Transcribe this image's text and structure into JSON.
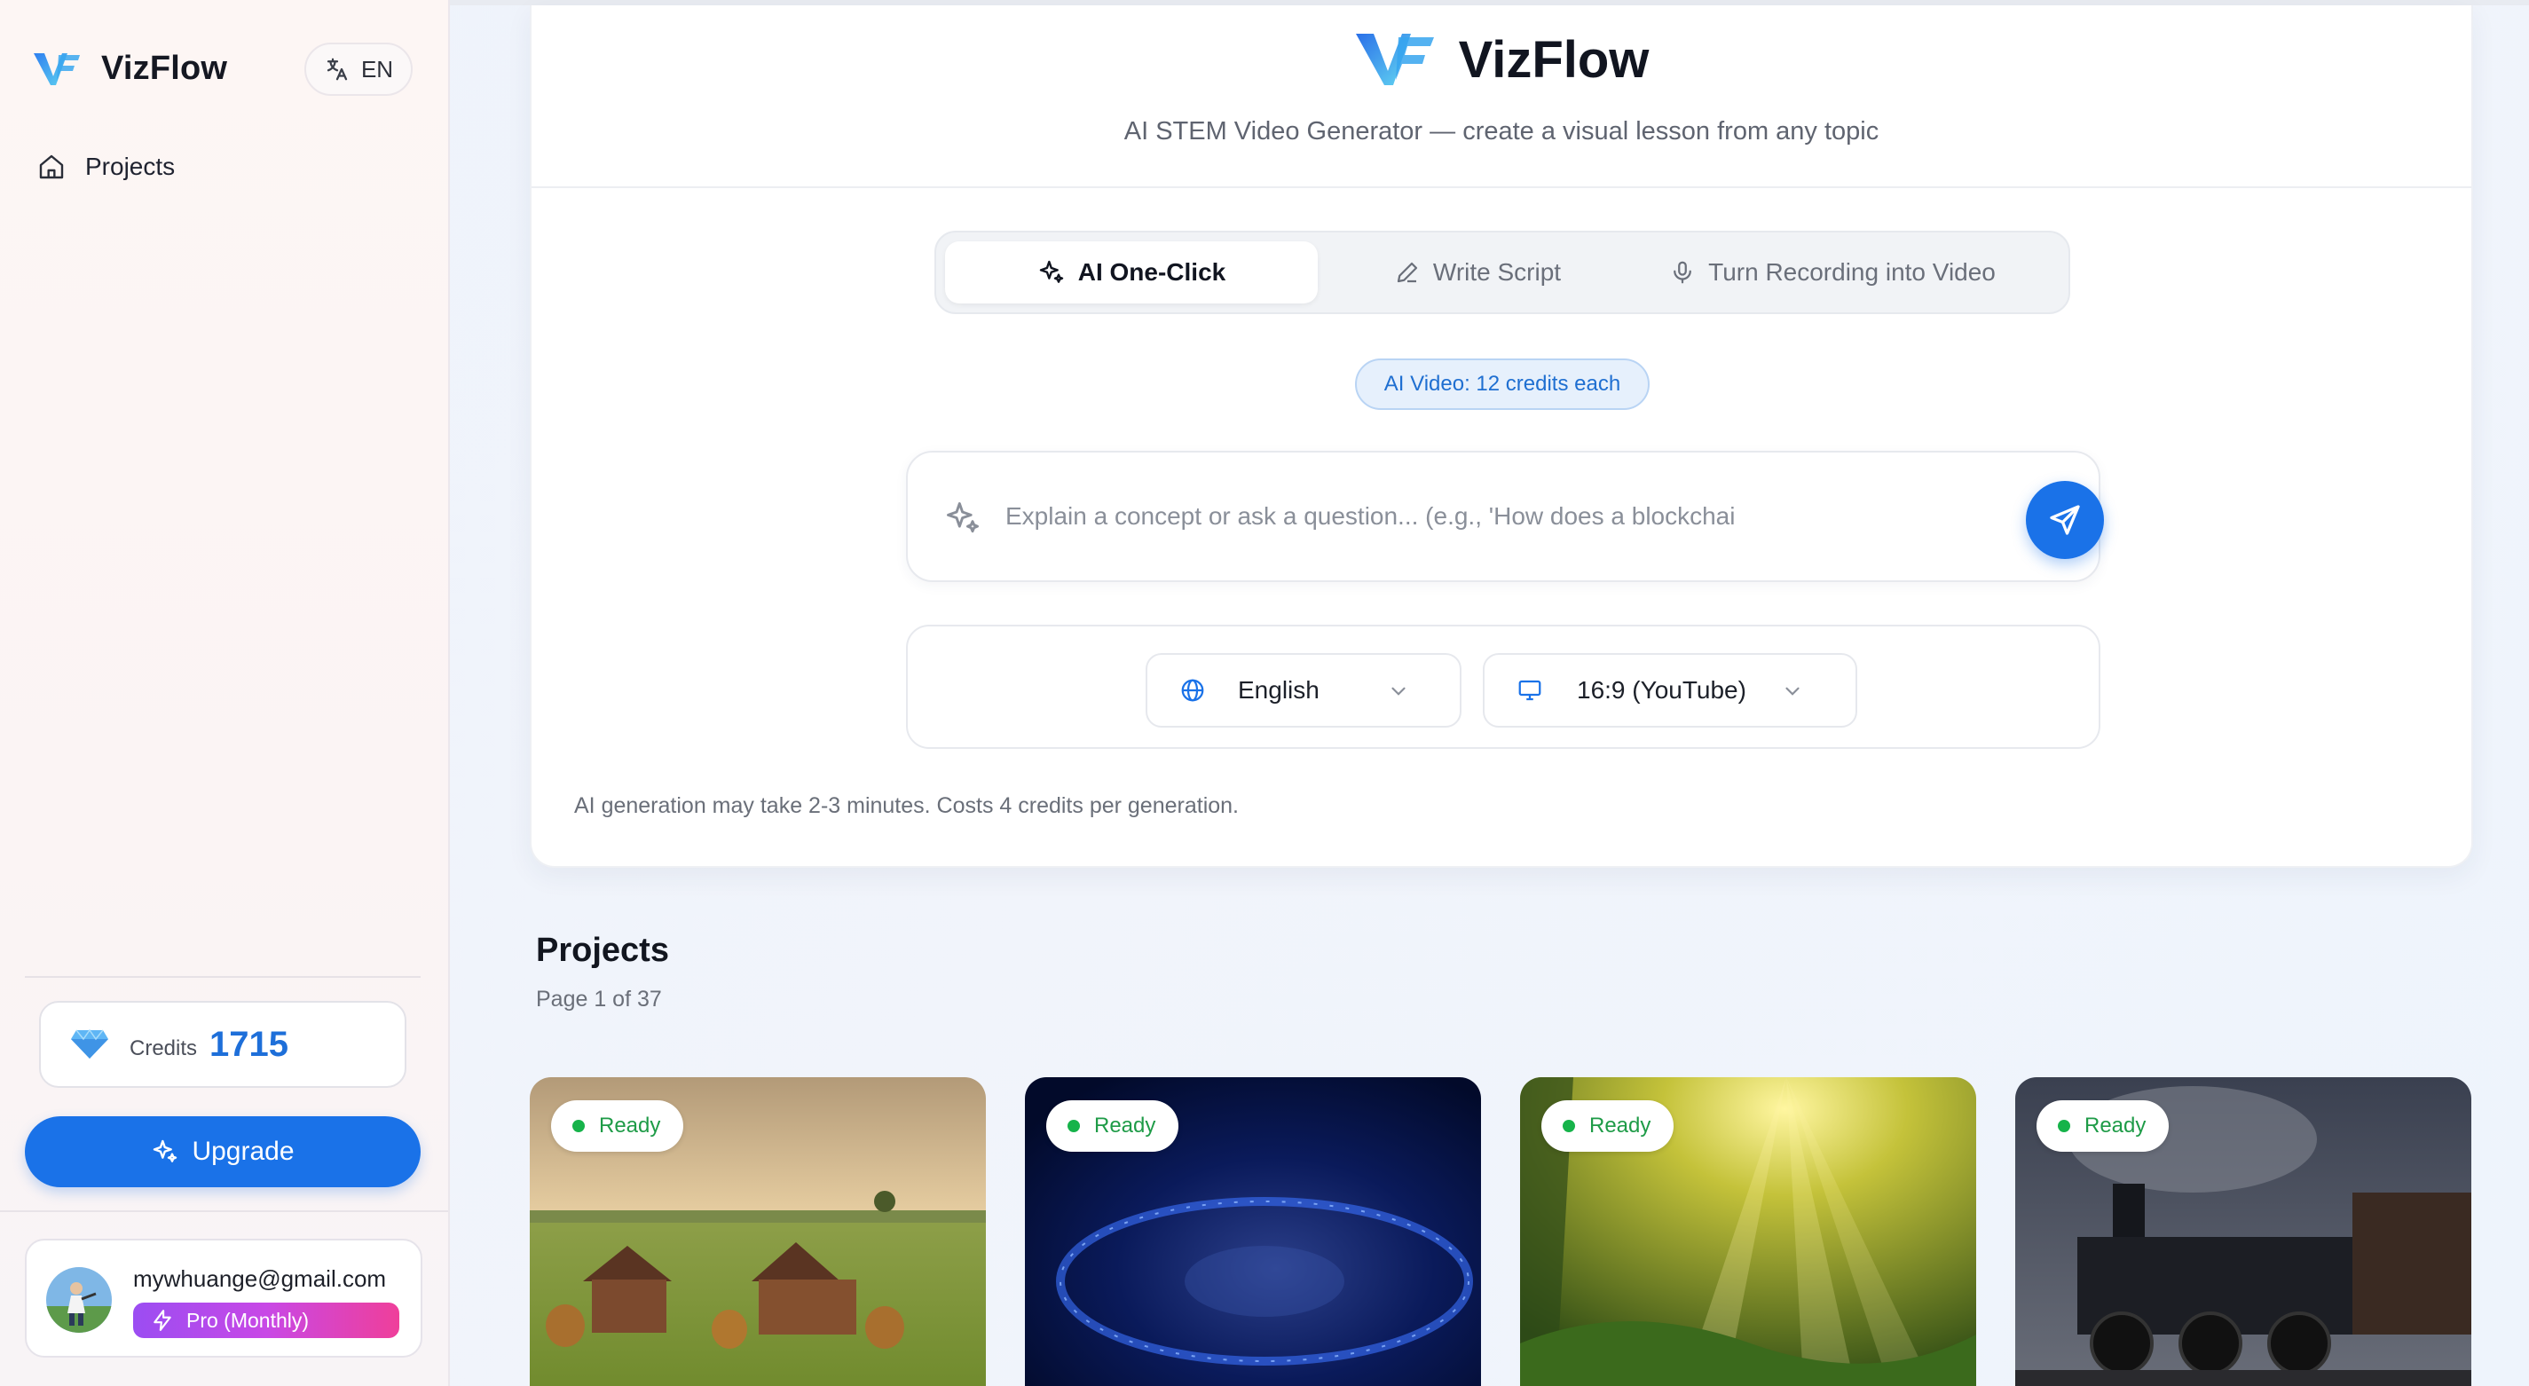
{
  "sidebar": {
    "brand": "VizFlow",
    "language_button": "EN",
    "nav": [
      {
        "label": "Projects",
        "icon": "home-icon"
      }
    ],
    "credits": {
      "label": "Credits",
      "value": "1715"
    },
    "upgrade_label": "Upgrade",
    "user": {
      "email": "mywhuange@gmail.com",
      "plan": "Pro (Monthly)"
    }
  },
  "header": {
    "title": "VizFlow",
    "subtitle": "AI STEM Video Generator — create a visual lesson from any topic"
  },
  "tabs": [
    {
      "label": "AI One-Click",
      "icon": "sparkles-icon",
      "active": true
    },
    {
      "label": "Write Script",
      "icon": "pencil-icon",
      "active": false
    },
    {
      "label": "Turn Recording into Video",
      "icon": "microphone-icon",
      "active": false
    }
  ],
  "credit_pill": "AI Video: 12 credits each",
  "prompt": {
    "placeholder": "Explain a concept or ask a question... (e.g., 'How does a blockchai"
  },
  "options": {
    "language": "English",
    "aspect_ratio": "16:9 (YouTube)"
  },
  "note": "AI generation may take 2-3 minutes. Costs 4 credits per generation.",
  "projects": {
    "title": "Projects",
    "page": "Page 1 of 37",
    "items": [
      {
        "status": "Ready"
      },
      {
        "status": "Ready"
      },
      {
        "status": "Ready"
      },
      {
        "status": "Ready"
      }
    ]
  },
  "colors": {
    "accent": "#1a72e8",
    "ready": "#16b34a",
    "plan_gradient_start": "#9b4df2",
    "plan_gradient_end": "#ef3f9a"
  }
}
